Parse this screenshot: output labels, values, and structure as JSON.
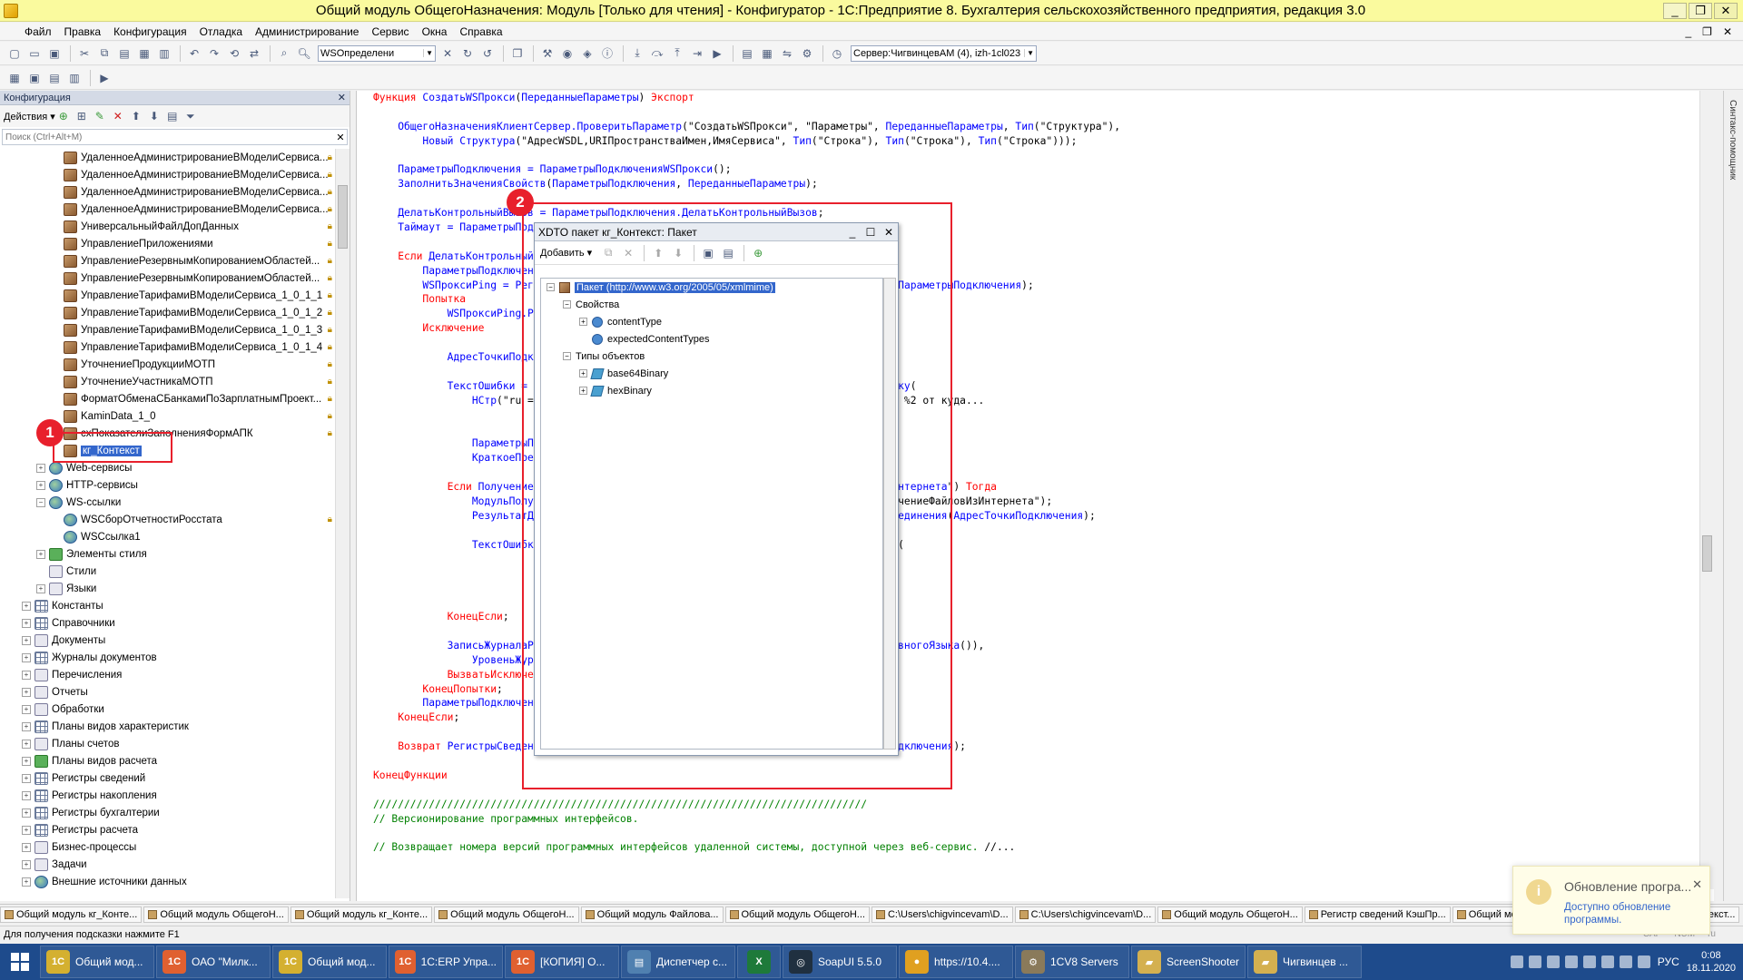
{
  "window": {
    "title": "Общий модуль ОбщегоНазначения: Модуль [Только для чтения] - Конфигуратор - 1С:Предприятие 8. Бухгалтерия сельскохозяйственного предприятия, редакция 3.0",
    "controls": [
      "_",
      "❐",
      "✕"
    ]
  },
  "menu": {
    "items": [
      "Файл",
      "Правка",
      "Конфигурация",
      "Отладка",
      "Администрирование",
      "Сервис",
      "Окна",
      "Справка"
    ],
    "mdi_controls": [
      "_",
      "❐",
      "✕"
    ]
  },
  "toolbar": {
    "search_value": "WSОпределени",
    "server_value": "Сервер:ЧигвинцевАМ (4), izh-1cl023"
  },
  "left_panel": {
    "title": "Конфигурация",
    "actions_label": "Действия",
    "search_placeholder": "Поиск (Ctrl+Alt+M)",
    "tree": [
      {
        "label": "УдаленноеАдминистрированиеВМоделиСервиса...",
        "indent": 3,
        "icon": "box",
        "lock": true,
        "exp": ""
      },
      {
        "label": "УдаленноеАдминистрированиеВМоделиСервиса...",
        "indent": 3,
        "icon": "box",
        "lock": true,
        "exp": ""
      },
      {
        "label": "УдаленноеАдминистрированиеВМоделиСервиса...",
        "indent": 3,
        "icon": "box",
        "lock": true,
        "exp": ""
      },
      {
        "label": "УдаленноеАдминистрированиеВМоделиСервиса...",
        "indent": 3,
        "icon": "box",
        "lock": true,
        "exp": ""
      },
      {
        "label": "УниверсальныйФайлДопДанных",
        "indent": 3,
        "icon": "box",
        "lock": true,
        "exp": ""
      },
      {
        "label": "УправлениеПриложениями",
        "indent": 3,
        "icon": "box",
        "lock": true,
        "exp": ""
      },
      {
        "label": "УправлениеРезервнымКопированиемОбластей...",
        "indent": 3,
        "icon": "box",
        "lock": true,
        "exp": ""
      },
      {
        "label": "УправлениеРезервнымКопированиемОбластей...",
        "indent": 3,
        "icon": "box",
        "lock": true,
        "exp": ""
      },
      {
        "label": "УправлениеТарифамиВМоделиСервиса_1_0_1_1",
        "indent": 3,
        "icon": "box",
        "lock": true,
        "exp": ""
      },
      {
        "label": "УправлениеТарифамиВМоделиСервиса_1_0_1_2",
        "indent": 3,
        "icon": "box",
        "lock": true,
        "exp": ""
      },
      {
        "label": "УправлениеТарифамиВМоделиСервиса_1_0_1_3",
        "indent": 3,
        "icon": "box",
        "lock": true,
        "exp": ""
      },
      {
        "label": "УправлениеТарифамиВМоделиСервиса_1_0_1_4",
        "indent": 3,
        "icon": "box",
        "lock": true,
        "exp": ""
      },
      {
        "label": "УточнениеПродукцииМОТП",
        "indent": 3,
        "icon": "box",
        "lock": true,
        "exp": ""
      },
      {
        "label": "УточнениеУчастникаМОТП",
        "indent": 3,
        "icon": "box",
        "lock": true,
        "exp": ""
      },
      {
        "label": "ФорматОбменаСБанкамиПоЗарплатнымПроект...",
        "indent": 3,
        "icon": "box",
        "lock": true,
        "exp": ""
      },
      {
        "label": "KaminData_1_0",
        "indent": 3,
        "icon": "box",
        "lock": true,
        "exp": ""
      },
      {
        "label": "схПоказателиЗаполненияФормАПК",
        "indent": 3,
        "icon": "box",
        "lock": true,
        "exp": ""
      },
      {
        "label": "кг_Контекст",
        "indent": 3,
        "icon": "box",
        "lock": false,
        "exp": "",
        "selected": true
      },
      {
        "label": "Web-сервисы",
        "indent": 2,
        "icon": "globe",
        "lock": false,
        "exp": "+"
      },
      {
        "label": "HTTP-сервисы",
        "indent": 2,
        "icon": "globe",
        "lock": false,
        "exp": "+"
      },
      {
        "label": "WS-ссылки",
        "indent": 2,
        "icon": "globe",
        "lock": false,
        "exp": "−"
      },
      {
        "label": "WSСборОтчетностиРосстата",
        "indent": 3,
        "icon": "globe",
        "lock": true,
        "exp": ""
      },
      {
        "label": "WSСсылка1",
        "indent": 3,
        "icon": "globe",
        "lock": false,
        "exp": ""
      },
      {
        "label": "Элементы стиля",
        "indent": 2,
        "icon": "green",
        "lock": false,
        "exp": "+"
      },
      {
        "label": "Стили",
        "indent": 2,
        "icon": "book",
        "lock": false,
        "exp": ""
      },
      {
        "label": "Языки",
        "indent": 2,
        "icon": "book",
        "lock": false,
        "exp": "+"
      },
      {
        "label": "Константы",
        "indent": 1,
        "icon": "grid",
        "lock": false,
        "exp": "+"
      },
      {
        "label": "Справочники",
        "indent": 1,
        "icon": "grid",
        "lock": false,
        "exp": "+"
      },
      {
        "label": "Документы",
        "indent": 1,
        "icon": "book",
        "lock": false,
        "exp": "+"
      },
      {
        "label": "Журналы документов",
        "indent": 1,
        "icon": "grid",
        "lock": false,
        "exp": "+"
      },
      {
        "label": "Перечисления",
        "indent": 1,
        "icon": "book",
        "lock": false,
        "exp": "+"
      },
      {
        "label": "Отчеты",
        "indent": 1,
        "icon": "book",
        "lock": false,
        "exp": "+"
      },
      {
        "label": "Обработки",
        "indent": 1,
        "icon": "book",
        "lock": false,
        "exp": "+"
      },
      {
        "label": "Планы видов характеристик",
        "indent": 1,
        "icon": "grid",
        "lock": false,
        "exp": "+"
      },
      {
        "label": "Планы счетов",
        "indent": 1,
        "icon": "book",
        "lock": false,
        "exp": "+"
      },
      {
        "label": "Планы видов расчета",
        "indent": 1,
        "icon": "green",
        "lock": false,
        "exp": "+"
      },
      {
        "label": "Регистры сведений",
        "indent": 1,
        "icon": "grid",
        "lock": false,
        "exp": "+"
      },
      {
        "label": "Регистры накопления",
        "indent": 1,
        "icon": "grid",
        "lock": false,
        "exp": "+"
      },
      {
        "label": "Регистры бухгалтерии",
        "indent": 1,
        "icon": "grid",
        "lock": false,
        "exp": "+"
      },
      {
        "label": "Регистры расчета",
        "indent": 1,
        "icon": "grid",
        "lock": false,
        "exp": "+"
      },
      {
        "label": "Бизнес-процессы",
        "indent": 1,
        "icon": "book",
        "lock": false,
        "exp": "+"
      },
      {
        "label": "Задачи",
        "indent": 1,
        "icon": "book",
        "lock": false,
        "exp": "+"
      },
      {
        "label": "Внешние источники данных",
        "indent": 1,
        "icon": "globe",
        "lock": false,
        "exp": "+"
      }
    ]
  },
  "code_lines": [
    [
      [
        "kw",
        "Функция "
      ],
      [
        "id",
        "СоздатьWSПрокси"
      ],
      [
        "str",
        "("
      ],
      [
        "id",
        "ПереданныеПараметры"
      ],
      [
        "str",
        ") "
      ],
      [
        "kw",
        "Экспорт"
      ]
    ],
    [],
    [
      [
        "str",
        "    "
      ],
      [
        "id",
        "ОбщегоНазначенияКлиентСервер.ПроверитьПараметр"
      ],
      [
        "str",
        "(\"СоздатьWSПрокси\", \"Параметры\", "
      ],
      [
        "id",
        "ПереданныеПараметры"
      ],
      [
        "str",
        ", "
      ],
      [
        "id",
        "Тип"
      ],
      [
        "str",
        "(\"Структура\"),"
      ]
    ],
    [
      [
        "str",
        "        "
      ],
      [
        "id",
        "Новый Структура"
      ],
      [
        "str",
        "(\"АдресWSDL,URIПространстваИмен,ИмяСервиса\", "
      ],
      [
        "id",
        "Тип"
      ],
      [
        "str",
        "(\"Строка\"), "
      ],
      [
        "id",
        "Тип"
      ],
      [
        "str",
        "(\"Строка\"), "
      ],
      [
        "id",
        "Тип"
      ],
      [
        "str",
        "(\"Строка\")));"
      ]
    ],
    [],
    [
      [
        "str",
        "    "
      ],
      [
        "id",
        "ПараметрыПодключения = ПараметрыПодключенияWSПрокси"
      ],
      [
        "str",
        "();"
      ]
    ],
    [
      [
        "str",
        "    "
      ],
      [
        "id",
        "ЗаполнитьЗначенияСвойств"
      ],
      [
        "str",
        "("
      ],
      [
        "id",
        "ПараметрыПодключения"
      ],
      [
        "str",
        ", "
      ],
      [
        "id",
        "ПереданныеПараметры"
      ],
      [
        "str",
        ");"
      ]
    ],
    [],
    [
      [
        "str",
        "    "
      ],
      [
        "id",
        "ДелатьКонтрольныйВызов = ПараметрыПодключения.ДелатьКонтрольныйВызов"
      ],
      [
        "str",
        ";"
      ]
    ],
    [
      [
        "str",
        "    "
      ],
      [
        "id",
        "Таймаут = ПараметрыПодключения.Таймаут"
      ],
      [
        "str",
        ";"
      ]
    ],
    [],
    [
      [
        "str",
        "    "
      ],
      [
        "kw",
        "Если "
      ],
      [
        "id",
        "ДелатьКонтрольныйВызов "
      ],
      [
        "kw",
        "И "
      ],
      [
        "id",
        "Таймаут "
      ],
      [
        "kw",
        "<> Неопределено И "
      ],
      [
        "id",
        "Таймаут "
      ],
      [
        "kw",
        "> "
      ],
      [
        "str",
        "20 "
      ],
      [
        "kw",
        "Тогда"
      ]
    ],
    [
      [
        "str",
        "        "
      ],
      [
        "id",
        "ПараметрыПодключенияPing = Новый Структура(ПараметрыПодключения)"
      ],
      [
        "str",
        ";"
      ]
    ],
    [
      [
        "str",
        "        "
      ],
      [
        "id",
        "WSПроксиPing = РегистрыСведений.КэшПрограммныхИнтерфейсов.ВнутренняяWSПрокси"
      ],
      [
        "str",
        "("
      ],
      [
        "id",
        "ПараметрыПодключения"
      ],
      [
        "str",
        ");"
      ]
    ],
    [
      [
        "str",
        "        "
      ],
      [
        "kw",
        "Попытка"
      ]
    ],
    [
      [
        "str",
        "            "
      ],
      [
        "id",
        "WSПроксиPing.Ping"
      ],
      [
        "str",
        "();"
      ]
    ],
    [
      [
        "str",
        "        "
      ],
      [
        "kw",
        "Исключение"
      ]
    ],
    [],
    [
      [
        "str",
        "            "
      ],
      [
        "id",
        "АдресТочкиПодключения = WSПроксиPing.ТочкаПодключения.Местоположение"
      ],
      [
        "str",
        ";"
      ]
    ],
    [],
    [
      [
        "str",
        "            "
      ],
      [
        "id",
        "ТекстОшибки = ОбработкаОшибок.ПодробноеПредставлениеОшибки.ПараметрыВСтроку"
      ],
      [
        "str",
        "("
      ]
    ],
    [
      [
        "str",
        "                "
      ],
      [
        "id",
        "НСтр"
      ],
      [
        "str",
        "(\"ru = 'Не удалось проверить доступность веб-сервиса %1 по адресу %2 от куда..."
      ]
    ],
    [],
    [],
    [
      [
        "str",
        "                "
      ],
      [
        "id",
        "ПараметрыПодключения.АдресWSDL"
      ],
      [
        "str",
        ","
      ]
    ],
    [
      [
        "str",
        "                "
      ],
      [
        "id",
        "КраткоеПредставлениеОшибки"
      ],
      [
        "str",
        "());"
      ]
    ],
    [],
    [
      [
        "str",
        "            "
      ],
      [
        "kw",
        "Если "
      ],
      [
        "id",
        "ПолучениеФайловИзИнтернетаКлиентСервер.ПодключениеПолучениеФайловИзИнтернета"
      ],
      [
        "str",
        "\") "
      ],
      [
        "kw",
        "Тогда"
      ]
    ],
    [
      [
        "str",
        "                "
      ],
      [
        "id",
        "МодульПолучениеФайловИзИнтернета = ОбщегоНазначения.ОбщийМодуль"
      ],
      [
        "str",
        "(\"ПолучениеФайловИзИнтернета\");"
      ]
    ],
    [
      [
        "str",
        "                "
      ],
      [
        "id",
        "РезультатДиагностики = МодульПолучениеФайловИзИнтернета.ДиагностикаСоединения"
      ],
      [
        "str",
        "("
      ],
      [
        "id",
        "АдресТочкиПодключения"
      ],
      [
        "str",
        ");"
      ]
    ],
    [],
    [
      [
        "str",
        "                "
      ],
      [
        "id",
        "ТекстОшибки = СтроковыеФункцииКлиентСервер.ПодставитьПараметрыВСтроку"
      ],
      [
        "str",
        "("
      ]
    ],
    [],
    [],
    [],
    [],
    [
      [
        "str",
        "            "
      ],
      [
        "kw",
        "КонецЕсли"
      ],
      [
        "str",
        ";"
      ]
    ],
    [],
    [
      [
        "str",
        "            "
      ],
      [
        "id",
        "ЗаписьЖурналаРегистрации(НСтр(\"ru = 'WSПрокси'\", ОбщегоНазначения.КодОсновногоЯзыка"
      ],
      [
        "str",
        "()),"
      ]
    ],
    [
      [
        "str",
        "                "
      ],
      [
        "id",
        "УровеньЖурналаРегистрации.Ошибка"
      ],
      [
        "str",
        ",,, ТекстОшибки);"
      ]
    ],
    [
      [
        "str",
        "            "
      ],
      [
        "kw",
        "ВызватьИсключение "
      ],
      [
        "id",
        "ТекстОшибки"
      ],
      [
        "str",
        ";"
      ]
    ],
    [
      [
        "str",
        "        "
      ],
      [
        "kw",
        "КонецПопытки"
      ],
      [
        "str",
        ";"
      ]
    ],
    [
      [
        "str",
        "        "
      ],
      [
        "id",
        "ПараметрыПодключения.Таймаут = Таймаут"
      ],
      [
        "str",
        ";"
      ]
    ],
    [
      [
        "str",
        "    "
      ],
      [
        "kw",
        "КонецЕсли"
      ],
      [
        "str",
        ";"
      ]
    ],
    [],
    [
      [
        "str",
        "    "
      ],
      [
        "kw",
        "Возврат "
      ],
      [
        "id",
        "РегистрыСведений.КэшПрограммныхИнтерфейсов.ВнутренняяWSПрокси"
      ],
      [
        "str",
        "("
      ],
      [
        "id",
        "ПараметрыПодключения"
      ],
      [
        "str",
        ");"
      ]
    ],
    [],
    [
      [
        "kw",
        "КонецФункции"
      ]
    ],
    [],
    [
      [
        "cm",
        "////////////////////////////////////////////////////////////////////////////////"
      ]
    ],
    [
      [
        "cm",
        "// Версионирование программных интерфейсов."
      ]
    ],
    [],
    [
      [
        "cm",
        "// Возвращает номера версий программных интерфейсов удаленной системы, доступной через веб-сервис. "
      ],
      [
        "str",
        "//..."
      ]
    ]
  ],
  "right_strip": {
    "label": "Синтакс-помощник"
  },
  "xdto": {
    "title": "XDTO пакет кг_Контекст: Пакет",
    "add_label": "Добавить",
    "controls": [
      "_",
      "☐",
      "✕"
    ],
    "tree": [
      {
        "label": "Пакет (http://www.w3.org/2005/05/xmlmime)",
        "indent": 0,
        "icon": "pkg",
        "exp": "−",
        "selected": true
      },
      {
        "label": "Свойства",
        "indent": 1,
        "icon": "",
        "exp": "−"
      },
      {
        "label": "contentType",
        "indent": 2,
        "icon": "prop",
        "exp": "+"
      },
      {
        "label": "expectedContentTypes",
        "indent": 2,
        "icon": "prop",
        "exp": ""
      },
      {
        "label": "Типы объектов",
        "indent": 1,
        "icon": "",
        "exp": "−"
      },
      {
        "label": "base64Binary",
        "indent": 2,
        "icon": "type",
        "exp": "+"
      },
      {
        "label": "hexBinary",
        "indent": 2,
        "icon": "type",
        "exp": "+"
      }
    ]
  },
  "markers": {
    "one": "1",
    "two": "2"
  },
  "open_tabs": [
    "Общий модуль кг_Конте...",
    "Общий модуль ОбщегоН...",
    "Общий модуль кг_Конте...",
    "Общий модуль ОбщегоН...",
    "Общий модуль Файлова...",
    "Общий модуль ОбщегоН...",
    "C:\\Users\\chigvincevam\\D...",
    "C:\\Users\\chigvincevam\\D...",
    "Общий модуль ОбщегоН...",
    "Регистр сведений КэшПр...",
    "Общий модуль ОбщегоН...",
    "XDTO пакет кг_Контекст..."
  ],
  "status": {
    "hint": "Для получения подсказки нажмите F1",
    "ind": [
      "CAP",
      "NUM",
      "ru"
    ]
  },
  "notification": {
    "title": "Обновление програ...",
    "body": "Доступно обновление программы."
  },
  "taskbar": {
    "apps": [
      {
        "label": "Общий мод...",
        "color": "#d4b030",
        "text": "1C"
      },
      {
        "label": "ОАО \"Милк...",
        "color": "#e06030",
        "text": "1С"
      },
      {
        "label": "Общий мод...",
        "color": "#d4b030",
        "text": "1C"
      },
      {
        "label": "1C:ERP Упра...",
        "color": "#e06030",
        "text": "1С"
      },
      {
        "label": "[КОПИЯ] О...",
        "color": "#e06030",
        "text": "1С"
      },
      {
        "label": "Диспетчер с...",
        "color": "#5080b0",
        "text": "▤"
      },
      {
        "label": "",
        "color": "#1e7a3a",
        "text": "X"
      },
      {
        "label": "SoapUI 5.5.0",
        "color": "#203040",
        "text": "◎"
      },
      {
        "label": "https://10.4....",
        "color": "#e0a020",
        "text": "●"
      },
      {
        "label": "1CV8 Servers",
        "color": "#8a7a5a",
        "text": "⚙"
      },
      {
        "label": "ScreenShooter",
        "color": "#d4b050",
        "text": "▰"
      },
      {
        "label": "Чигвинцев ...",
        "color": "#d4b050",
        "text": "▰"
      }
    ],
    "lang": "РУС",
    "time": "0:08",
    "date": "18.11.2020"
  }
}
